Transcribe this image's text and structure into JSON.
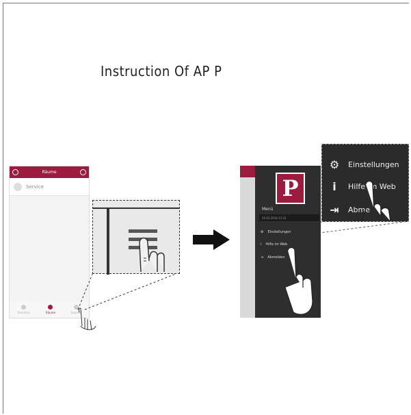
{
  "title": "Instruction Of AP P",
  "left_phone": {
    "header_title": "Räume",
    "service_label": "Service",
    "tabs": [
      "Favoriten",
      "Räume",
      "Szenen"
    ]
  },
  "right_phone": {
    "logo_letter": "P",
    "menu_title": "Menü",
    "date_text": "20.03.2014 13:31",
    "items": [
      "Einstellungen",
      "Hilfe im Web",
      "Abmelden"
    ]
  },
  "zoom_menu": {
    "items": [
      "Einstellungen",
      "Hilfe im Web",
      "Abme"
    ]
  }
}
